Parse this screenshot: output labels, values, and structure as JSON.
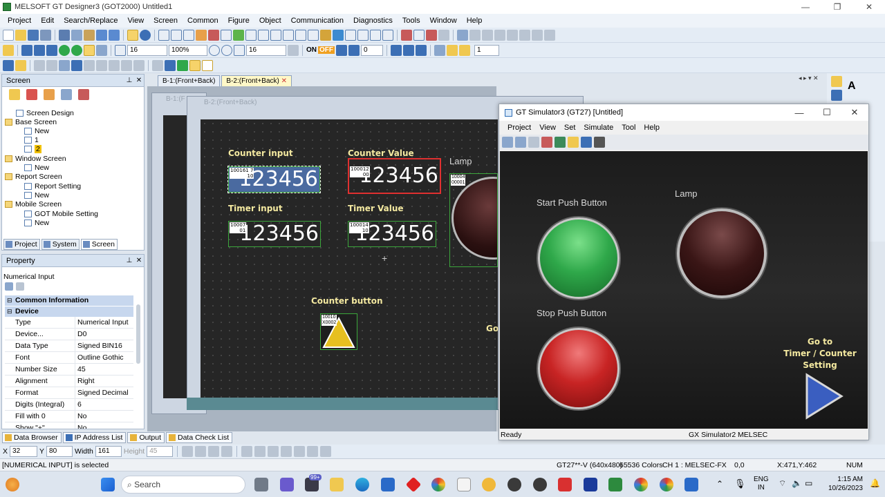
{
  "app": {
    "title": "MELSOFT GT Designer3 (GOT2000) Untitled1",
    "menu": [
      "Project",
      "Edit",
      "Search/Replace",
      "View",
      "Screen",
      "Common",
      "Figure",
      "Object",
      "Communication",
      "Diagnostics",
      "Tools",
      "Window",
      "Help"
    ]
  },
  "toolbar": {
    "font_size": "16",
    "zoom": "100%",
    "grid": "16",
    "on_label": "ON",
    "off_label": "OFF",
    "layer": "0",
    "station": "1"
  },
  "screen_panel": {
    "title": "Screen",
    "tree": [
      {
        "label": "Screen Design"
      },
      {
        "label": "Base Screen"
      },
      {
        "label": "New"
      },
      {
        "label": "1"
      },
      {
        "label": "2"
      },
      {
        "label": "Window Screen"
      },
      {
        "label": "New"
      },
      {
        "label": "Report Screen"
      },
      {
        "label": "Report Setting"
      },
      {
        "label": "New"
      },
      {
        "label": "Mobile Screen"
      },
      {
        "label": "GOT Mobile Setting"
      },
      {
        "label": "New"
      }
    ],
    "tabs": [
      "Project",
      "System",
      "Screen"
    ]
  },
  "property_panel": {
    "title": "Property",
    "object_type": "Numerical Input",
    "sections": [
      "Common Information",
      "Device"
    ],
    "rows": [
      {
        "k": "Type",
        "v": "Numerical Input"
      },
      {
        "k": "Device...",
        "v": "D0"
      },
      {
        "k": "Data Type",
        "v": "Signed BIN16"
      },
      {
        "k": "Font",
        "v": "Outline Gothic"
      },
      {
        "k": "Number Size (Dot)",
        "v": "45"
      },
      {
        "k": "Alignment",
        "v": "Right"
      },
      {
        "k": "Format",
        "v": "Signed Decimal"
      },
      {
        "k": "Digits (Integral)",
        "v": "6"
      },
      {
        "k": "Fill with 0",
        "v": "No"
      },
      {
        "k": "Show \"+\"",
        "v": "No"
      }
    ]
  },
  "doc_tabs": [
    "B-1:(Front+Back)",
    "B-2:(Front+Back)"
  ],
  "bg_window_title": "B-1:(F",
  "editor_window_title": "B-2:(Front+Back)",
  "editor": {
    "counter_input_label": "Counter input",
    "counter_value_label": "Counter Value",
    "timer_input_label": "Timer input",
    "timer_value_label": "Timer Value",
    "counter_button_label": "Counter button",
    "lamp_label": "Lamp",
    "go_partial": "Go",
    "numeric_text": "123456",
    "dev_counter_input": "100161 7\n10",
    "dev_counter_value": "100012\n00",
    "dev_timer_input": "10007\n01",
    "dev_timer_value": "100014\n10",
    "dev_button": "10010\nX0002",
    "dev_lamp": "10004\n00001"
  },
  "simulator": {
    "title": "GT Simulator3 (GT27)  [Untitled]",
    "menu": [
      "Project",
      "View",
      "Set",
      "Simulate",
      "Tool",
      "Help"
    ],
    "start_label": "Start Push Button",
    "stop_label": "Stop Push Button",
    "lamp_label": "Lamp",
    "goto_label": "Go to\nTimer / Counter\nSetting",
    "status_left": "Ready",
    "status_mid": "GX Simulator2",
    "status_right": "MELSEC"
  },
  "bottom_tabs": [
    "Data Browser",
    "IP Address List",
    "Output",
    "Data Check List"
  ],
  "coords": {
    "x_label": "X",
    "x": "32",
    "y_label": "Y",
    "y": "80",
    "width_label": "Width",
    "width": "161",
    "height_label": "Height",
    "height": "45"
  },
  "statusbar": {
    "selected": "[NUMERICAL INPUT] is selected",
    "model": "GT27**-V (640x480)",
    "colors": "65536 Colors",
    "channel": "CH 1 : MELSEC-FX",
    "origin": "0,0",
    "cursor": "X:471,Y:462",
    "num": "NUM"
  },
  "taskbar": {
    "search_placeholder": "Search",
    "lang1": "ENG",
    "lang2": "IN",
    "time": "1:15 AM",
    "date": "10/26/2023",
    "badge": "99+"
  },
  "colors": {
    "accent": "#3c6fb5",
    "lamp_red": "#d42a2a",
    "btn_green": "#2fa84a"
  }
}
